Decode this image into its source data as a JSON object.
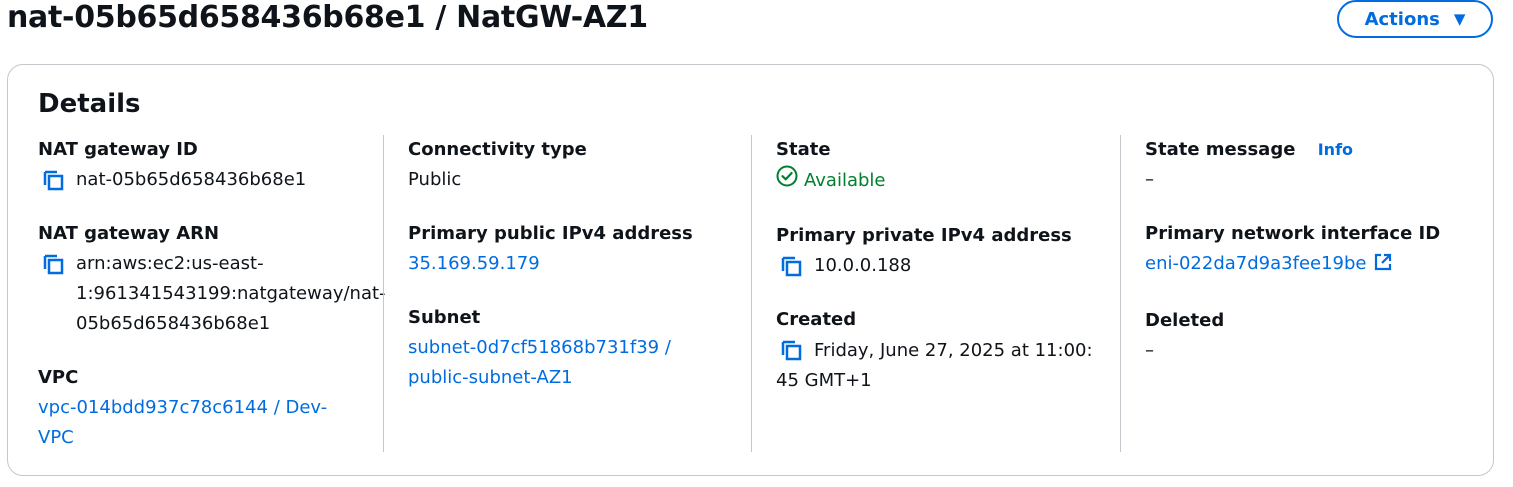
{
  "header": {
    "title": "nat-05b65d658436b68e1 / NatGW-AZ1",
    "actions_label": "Actions"
  },
  "details": {
    "title": "Details",
    "nat_gateway_id": {
      "label": "NAT gateway ID",
      "value": "nat-05b65d658436b68e1"
    },
    "nat_gateway_arn": {
      "label": "NAT gateway ARN",
      "value": "arn:aws:ec2:us-east-1:961341543199:natgateway/nat-05b65d658436b68e1"
    },
    "vpc": {
      "label": "VPC",
      "value": "vpc-014bdd937c78c6144 / Dev-VPC"
    },
    "connectivity_type": {
      "label": "Connectivity type",
      "value": "Public"
    },
    "primary_public_ipv4": {
      "label": "Primary public IPv4 address",
      "value": "35.169.59.179"
    },
    "subnet": {
      "label": "Subnet",
      "value": "subnet-0d7cf51868b731f39 / public-subnet-AZ1"
    },
    "state": {
      "label": "State",
      "value": "Available",
      "color": "#00802f"
    },
    "primary_private_ipv4": {
      "label": "Primary private IPv4 address",
      "value": "10.0.0.188"
    },
    "created": {
      "label": "Created",
      "value": "Friday, June 27, 2025 at 11:00:45 GMT+1"
    },
    "state_message": {
      "label": "State message",
      "info_label": "Info",
      "value": "–"
    },
    "primary_network_interface_id": {
      "label": "Primary network interface ID",
      "value": "eni-022da7d9a3fee19be"
    },
    "deleted": {
      "label": "Deleted",
      "value": "–"
    }
  },
  "icons": {
    "copy": "copy-icon",
    "status": "check-circle-icon",
    "external": "external-link-icon",
    "dropdown": "caret-down-icon"
  },
  "colors": {
    "link": "#006ce0",
    "success": "#00802f",
    "border": "#c6c6cd"
  }
}
